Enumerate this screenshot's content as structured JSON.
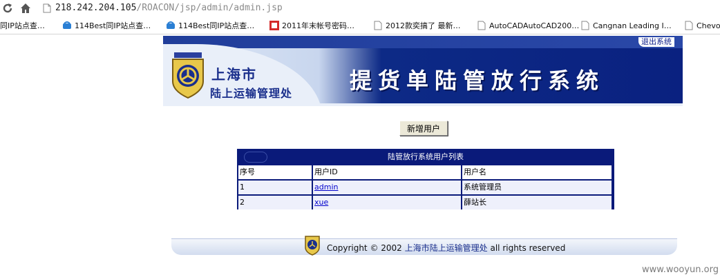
{
  "browser": {
    "url_host": "218.242.204.105",
    "url_path": "/ROACON/jsp/admin/admin.jsp",
    "bookmarks": [
      {
        "label": "同IP站点查…",
        "icon": "none"
      },
      {
        "label": "114Best同IP站点查…",
        "icon": "phone-icon"
      },
      {
        "label": "114Best同IP站点查…",
        "icon": "phone-icon"
      },
      {
        "label": "2011年末帐号密码…",
        "icon": "red-square-icon"
      },
      {
        "label": "2012款奕搞了 最新…",
        "icon": "page-icon"
      },
      {
        "label": "AutoCADAutoCAD200…",
        "icon": "page-icon"
      },
      {
        "label": "Cangnan Leading I…",
        "icon": "page-icon"
      },
      {
        "label": "Chevo",
        "icon": "page-icon"
      }
    ]
  },
  "header": {
    "logout": "退出系统",
    "org_line1": "上海市",
    "org_line2": "陆上运输管理处",
    "system_title": "提货单陆管放行系统"
  },
  "actions": {
    "add_user": "新增用户"
  },
  "user_table": {
    "caption": "陆管放行系统用户列表",
    "columns": [
      "序号",
      "用户ID",
      "用户名"
    ],
    "rows": [
      {
        "index": "1",
        "user_id": "admin",
        "user_name": "系统管理员"
      },
      {
        "index": "2",
        "user_id": "xue",
        "user_name": "薛站长"
      }
    ]
  },
  "footer": {
    "prefix": "Copyright © 2002",
    "org": "上海市陆上运输管理处",
    "suffix": "all rights reserved"
  },
  "watermark": "www.wooyun.org",
  "colors": {
    "banner_blue": "#0a2180",
    "table_border": "#0a1a7a",
    "link": "#0000cc"
  }
}
